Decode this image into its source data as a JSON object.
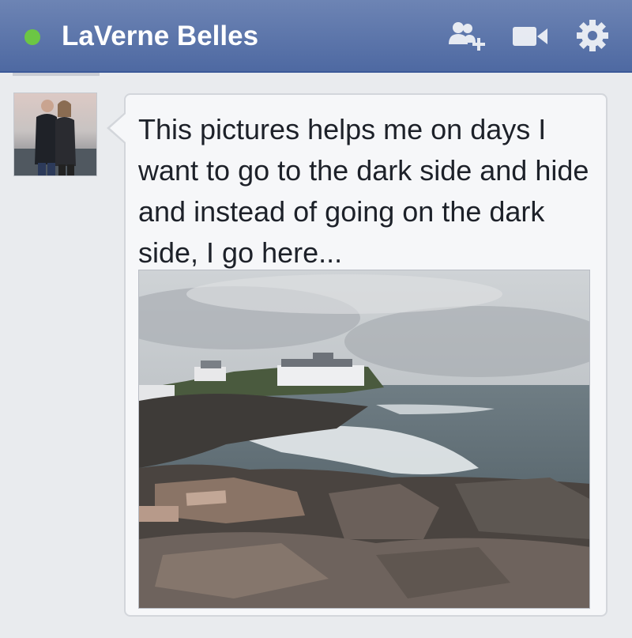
{
  "chat": {
    "contact_name": "LaVerne Belles",
    "status": "online",
    "status_color": "#6cc644",
    "header_icons": [
      "add-friend-icon",
      "video-call-icon",
      "gear-icon"
    ]
  },
  "message": {
    "text": "This pictures helps me on days I want to go to the dark side and hide and instead of going on the dark side, I go here...",
    "attachment": "photo"
  }
}
